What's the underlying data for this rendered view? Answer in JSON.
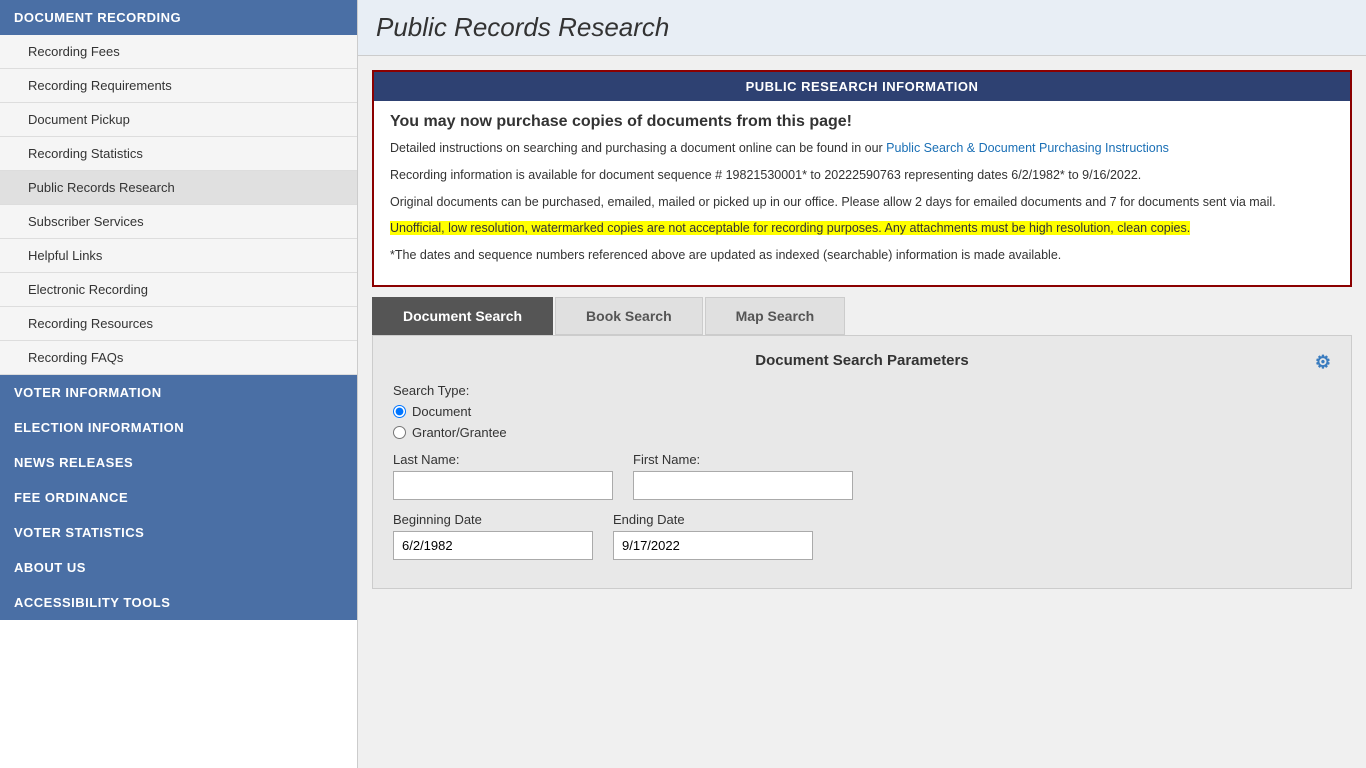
{
  "sidebar": {
    "sections": [
      {
        "id": "document-recording",
        "label": "DOCUMENT RECORDING",
        "items": [
          {
            "id": "recording-fees",
            "label": "Recording Fees",
            "active": false
          },
          {
            "id": "recording-requirements",
            "label": "Recording Requirements",
            "active": false
          },
          {
            "id": "document-pickup",
            "label": "Document Pickup",
            "active": false
          },
          {
            "id": "recording-statistics",
            "label": "Recording Statistics",
            "active": false
          },
          {
            "id": "public-records-research",
            "label": "Public Records Research",
            "active": true
          },
          {
            "id": "subscriber-services",
            "label": "Subscriber Services",
            "active": false
          },
          {
            "id": "helpful-links",
            "label": "Helpful Links",
            "active": false
          },
          {
            "id": "electronic-recording",
            "label": "Electronic Recording",
            "active": false
          },
          {
            "id": "recording-resources",
            "label": "Recording Resources",
            "active": false
          },
          {
            "id": "recording-faqs",
            "label": "Recording FAQs",
            "active": false
          }
        ]
      },
      {
        "id": "voter-information",
        "label": "VOTER INFORMATION",
        "items": []
      },
      {
        "id": "election-information",
        "label": "ELECTION INFORMATION",
        "items": []
      },
      {
        "id": "news-releases",
        "label": "NEWS RELEASES",
        "items": []
      },
      {
        "id": "fee-ordinance",
        "label": "FEE ORDINANCE",
        "items": []
      },
      {
        "id": "voter-statistics",
        "label": "VOTER STATISTICS",
        "items": []
      },
      {
        "id": "about-us",
        "label": "ABOUT US",
        "items": []
      },
      {
        "id": "accessibility-tools",
        "label": "ACCESSIBILITY TOOLS",
        "items": []
      }
    ]
  },
  "main": {
    "page_title": "Public Records Research",
    "info_box": {
      "header": "PUBLIC RESEARCH INFORMATION",
      "heading": "You may now purchase copies of documents from this page!",
      "para1_prefix": "Detailed instructions on searching and purchasing a document online can be found in our ",
      "para1_link": "Public Search & Document Purchasing Instructions",
      "para2": "Recording information is available for document sequence # 19821530001* to 20222590763 representing dates 6/2/1982* to 9/16/2022.",
      "para3": "Original documents can be purchased, emailed, mailed or picked up in our office. Please allow 2 days for emailed documents and 7 for documents sent via mail.",
      "para4_highlighted": "Unofficial, low resolution, watermarked copies are not acceptable for recording purposes. Any attachments must be high resolution, clean copies.",
      "para5": "*The dates and sequence numbers referenced above are updated as indexed (searchable) information is made available."
    },
    "tabs": [
      {
        "id": "document-search",
        "label": "Document Search",
        "active": true
      },
      {
        "id": "book-search",
        "label": "Book Search",
        "active": false
      },
      {
        "id": "map-search",
        "label": "Map Search",
        "active": false
      }
    ],
    "search_panel": {
      "title": "Document Search Parameters",
      "search_type_label": "Search Type:",
      "radio_options": [
        {
          "id": "radio-document",
          "label": "Document",
          "checked": true
        },
        {
          "id": "radio-grantor",
          "label": "Grantor/Grantee",
          "checked": false
        }
      ],
      "fields": {
        "last_name_label": "Last Name:",
        "last_name_value": "",
        "first_name_label": "First Name:",
        "first_name_value": "",
        "beginning_date_label": "Beginning Date",
        "beginning_date_value": "6/2/1982",
        "ending_date_label": "Ending Date",
        "ending_date_value": "9/17/2022"
      }
    }
  }
}
